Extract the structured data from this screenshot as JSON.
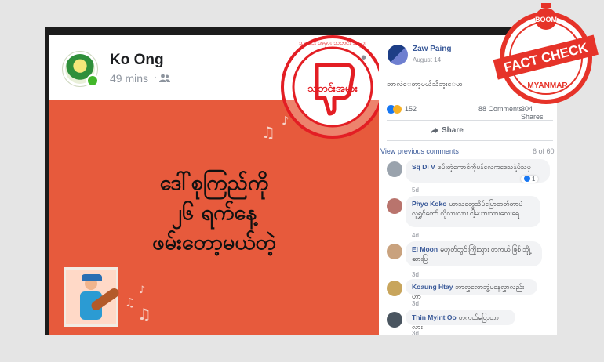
{
  "post": {
    "page_name": "Ko Ong",
    "time": "49 mins",
    "separator": "·",
    "more": "•••",
    "image_text": [
      "ဒေါ်စုကြည်ကို",
      "၂၆ ရက်နေ့",
      "ဖမ်းတော့မယ်တဲ့"
    ],
    "stamp_text": "သတင်းအမှား",
    "stamp_ring_text": "သတင်း အမှား သတင်း အမှား"
  },
  "comments_panel": {
    "author": "Zaw Paing",
    "date": "August 14 ·",
    "text": "ဘာလဲ‌ေတာ့မယ်သိဘူး‌ေဟ",
    "reactions": "152",
    "comments_count": "88 Comments",
    "shares_count": "304 Shares",
    "share_label": "Share",
    "view_previous": "View previous comments",
    "count_of": "6 of 60",
    "comments": [
      {
        "name": "Sq Di V",
        "text": "ဖမ်းတဲ့ကောင်ကိုပုန်လေကဒေသနဲ့ပ်သမ့",
        "date": "5d",
        "likes": "1"
      },
      {
        "name": "Phyo Koko",
        "text": "ဟာသတွေသိပ်ပြောတတ်တာပဲ လူရွှင်တော် လိုလားလား ငါ့မယားသားလေးရေ",
        "date": "4d"
      },
      {
        "name": "Ei Moon",
        "text": "မဟုတ်တွင်းကြိုးသွား တကယ် ဖြစ် ဘိုု့ဆားပြ",
        "date": "3d"
      },
      {
        "name": "Koaung Htay",
        "text": "ဘာလွှလောဘွဲ့မနေ့လွှာလည်းဟာ",
        "date": "3d"
      },
      {
        "name": "Thin Myint Oo",
        "text": "တကယ်ပြောတာလား",
        "date": "3d"
      }
    ]
  },
  "badge": {
    "top": "BOOM",
    "middle": "FACT CHECK",
    "bottom": "MYANMAR"
  },
  "colors": {
    "image_bg": "#e75a3c",
    "stamp_red": "#e31e24",
    "fb_blue": "#385898"
  }
}
